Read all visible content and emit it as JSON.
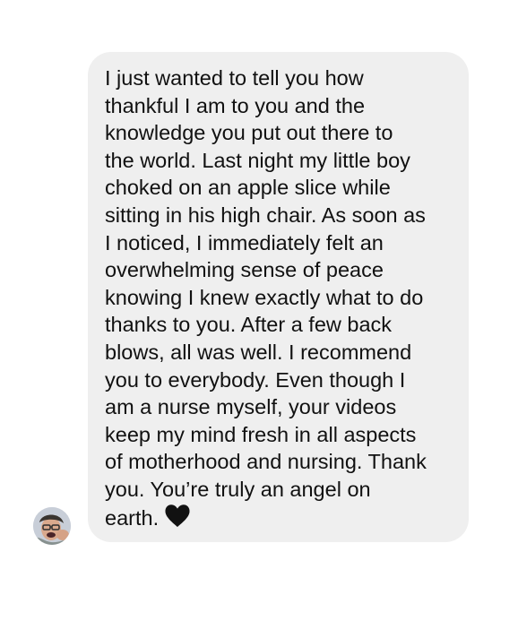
{
  "message": {
    "text_lines": "I just wanted to tell you how\nthankful I am to you and the\nknowledge you put out there to\nthe world. Last night my little boy\nchoked on an apple slice while\nsitting in his high chair. As soon as\nI noticed, I immediately felt an\noverwhelming sense of peace\nknowing I knew exactly what to do\nthanks to you. After a few back\nblows, all was well. I recommend\nyou to everybody. Even though I\nam a nurse myself, your videos\nkeep my mind fresh in all aspects\nof motherhood and nursing. Thank\nyou. You’re truly an angel on\nearth.",
    "trailing_emoji": "black-heart-icon"
  },
  "colors": {
    "page_background": "#ffffff",
    "bubble_background": "#efefef",
    "text": "#111111",
    "heart": "#111111"
  },
  "sender": {
    "avatar": "profile-avatar"
  }
}
